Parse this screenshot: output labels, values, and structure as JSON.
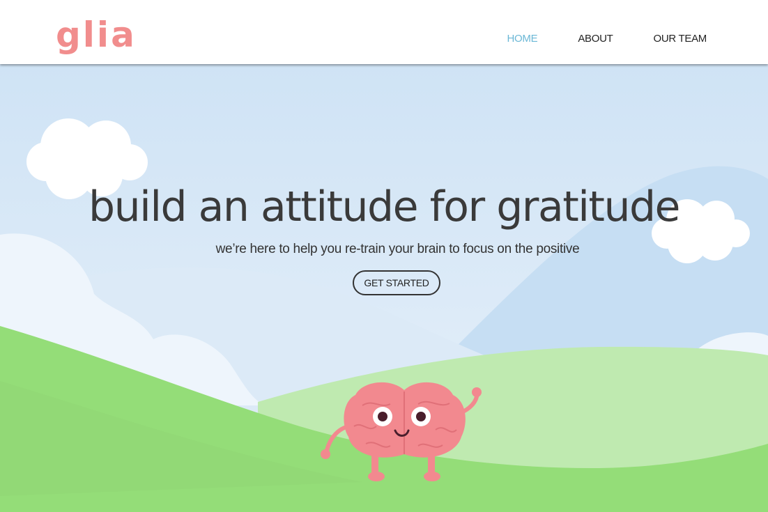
{
  "header": {
    "logo_text": "glia",
    "nav": [
      {
        "label": "HOME",
        "active": true
      },
      {
        "label": "ABOUT",
        "active": false
      },
      {
        "label": "OUR TEAM",
        "active": false
      }
    ]
  },
  "hero": {
    "headline": "build an attitude for gratitude",
    "subheadline": "we’re here to help you re-train your brain to focus on the positive",
    "cta_label": "GET STARTED",
    "mascot": "brain-mascot-illustration"
  },
  "colors": {
    "logo": "#f18d8d",
    "nav_active": "#6bb8d6",
    "nav_default": "#222222",
    "sky_top": "#cfe3f5",
    "sky_bottom": "#e6f0f9",
    "hill_dark": "#94dd78",
    "hill_light": "#bfeab0",
    "brain": "#f2898f"
  }
}
